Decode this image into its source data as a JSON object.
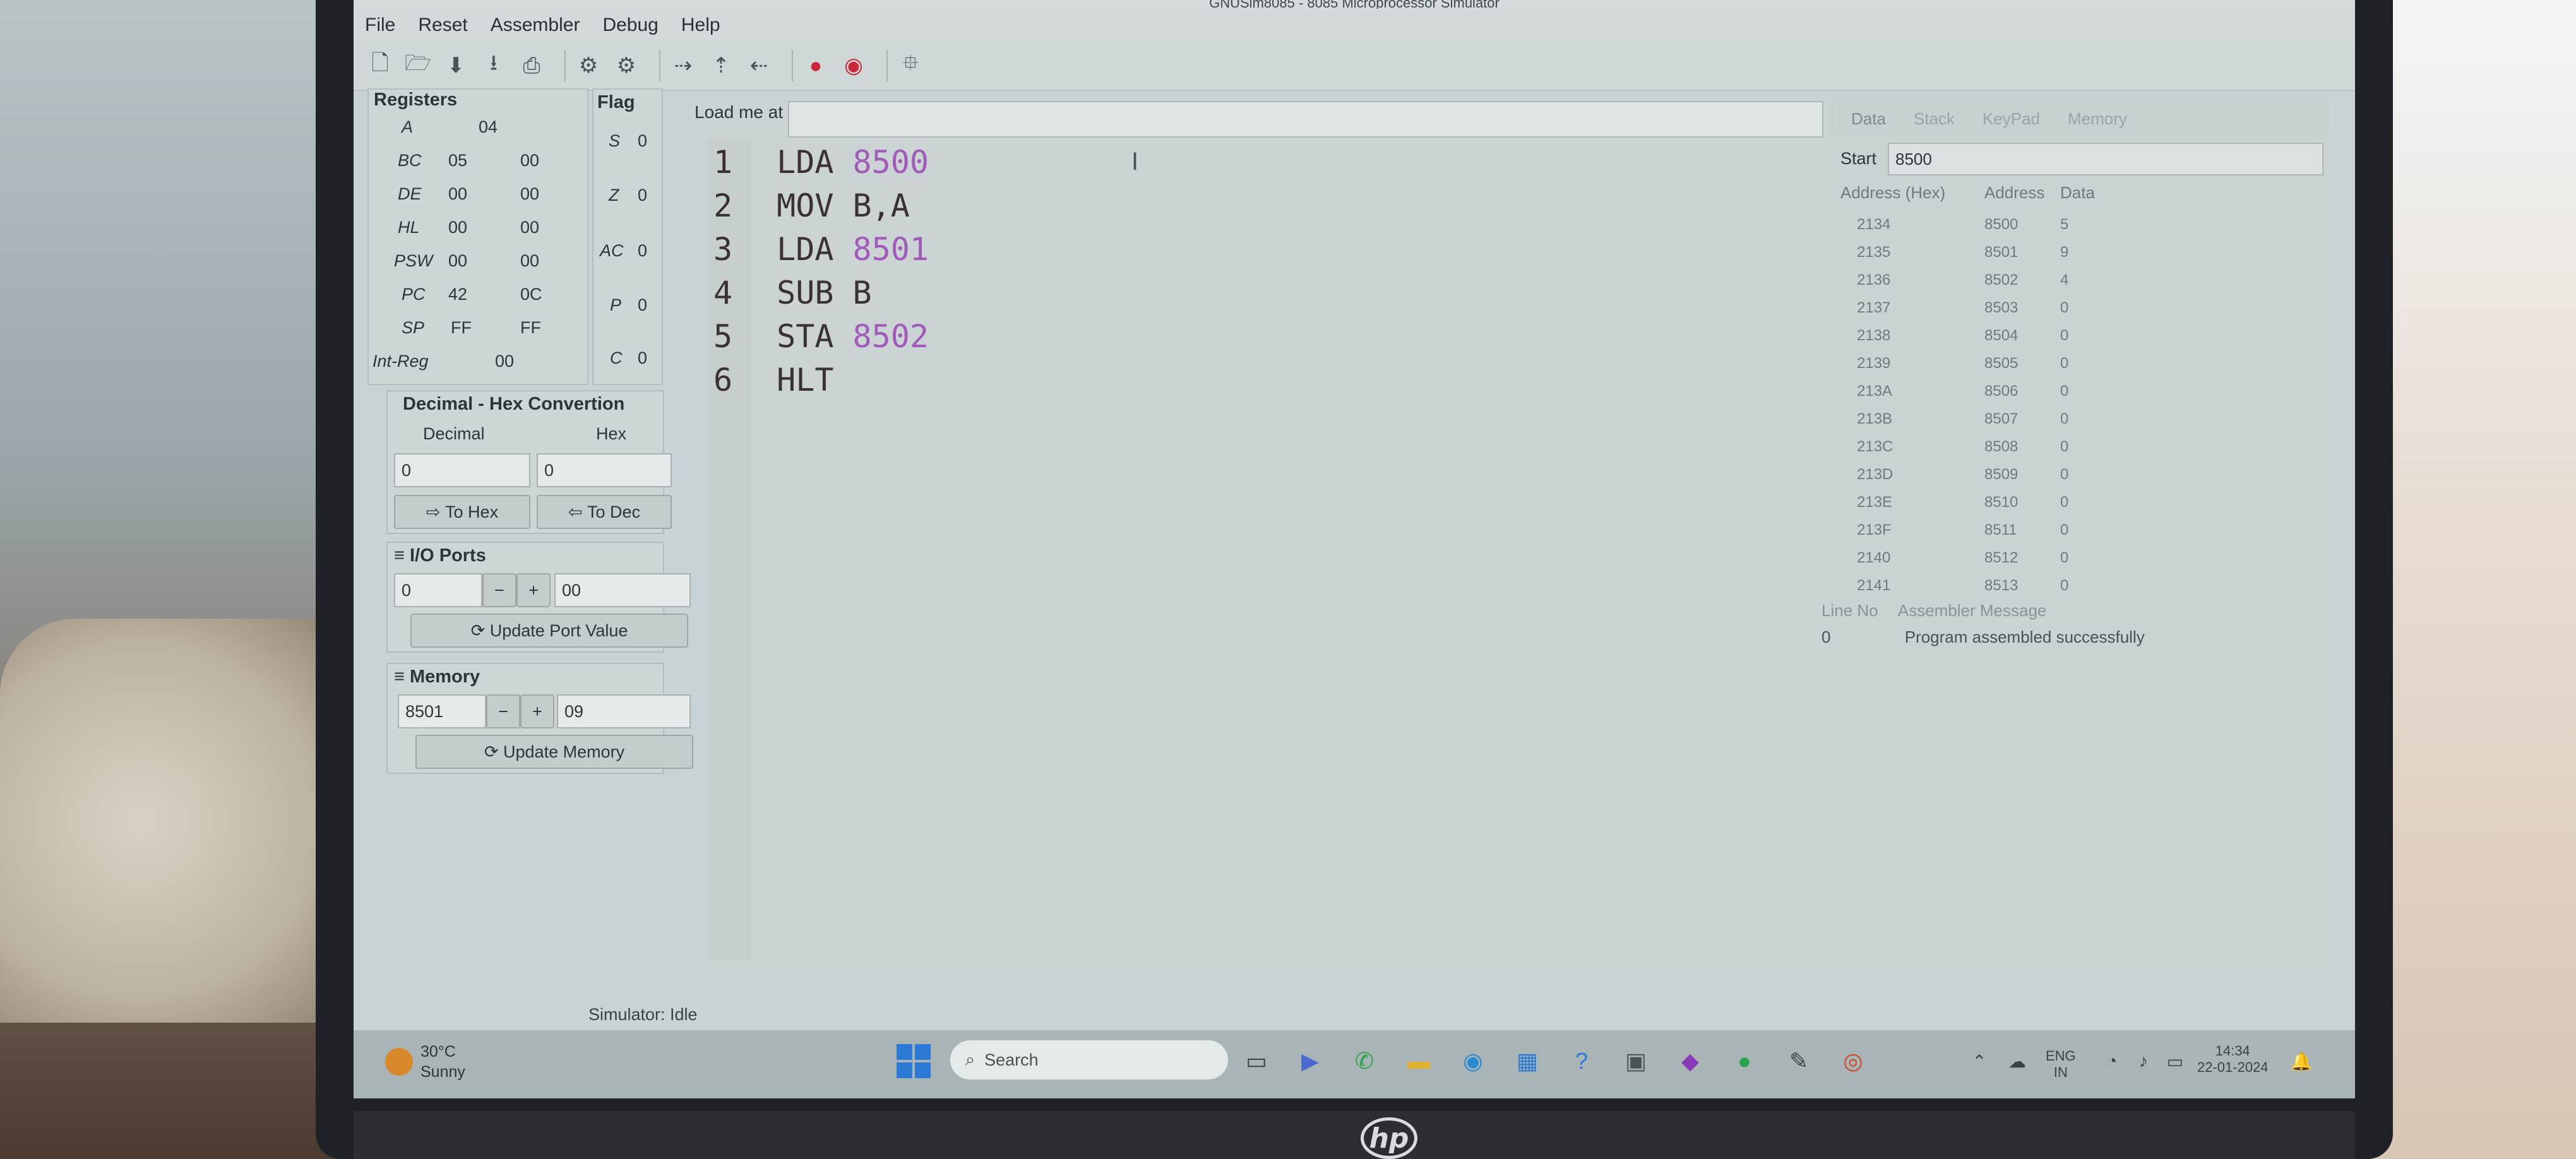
{
  "window": {
    "title": "GNUSim8085 - 8085 Microprocessor Simulator"
  },
  "menu": [
    "File",
    "Reset",
    "Assembler",
    "Debug",
    "Help"
  ],
  "registers": {
    "title": "Registers",
    "rows": [
      {
        "name": "A",
        "v1": "04",
        "v2": ""
      },
      {
        "name": "BC",
        "v1": "05",
        "v2": "00"
      },
      {
        "name": "DE",
        "v1": "00",
        "v2": "00"
      },
      {
        "name": "HL",
        "v1": "00",
        "v2": "00"
      },
      {
        "name": "PSW",
        "v1": "00",
        "v2": "00"
      },
      {
        "name": "PC",
        "v1": "42",
        "v2": "0C"
      },
      {
        "name": "SP",
        "v1": "FF",
        "v2": "FF"
      },
      {
        "name": "Int-Reg",
        "v1": "00",
        "v2": ""
      }
    ]
  },
  "flags": {
    "title": "Flag",
    "rows": [
      {
        "name": "S",
        "v": "0"
      },
      {
        "name": "Z",
        "v": "0"
      },
      {
        "name": "AC",
        "v": "0"
      },
      {
        "name": "P",
        "v": "0"
      },
      {
        "name": "C",
        "v": "0"
      }
    ]
  },
  "conversion": {
    "title": "Decimal - Hex Convertion",
    "decimal_label": "Decimal",
    "hex_label": "Hex",
    "decimal_value": "0",
    "hex_value": "0",
    "to_hex": "To Hex",
    "to_dec": "To Dec"
  },
  "io_ports": {
    "title": "I/O Ports",
    "port": "0",
    "minus": "−",
    "plus": "+",
    "value": "00",
    "update": "Update Port Value"
  },
  "memory": {
    "title": "Memory",
    "address": "8501",
    "minus": "−",
    "plus": "+",
    "value": "09",
    "update": "Update Memory"
  },
  "editor": {
    "load_label": "Load me at",
    "load_value": "",
    "lines": [
      {
        "n": "1",
        "op": "LDA",
        "arg": "8500",
        "numeric": true
      },
      {
        "n": "2",
        "op": "MOV",
        "arg": "B,A",
        "numeric": false
      },
      {
        "n": "3",
        "op": "LDA",
        "arg": "8501",
        "numeric": true
      },
      {
        "n": "4",
        "op": "SUB",
        "arg": "B",
        "numeric": false
      },
      {
        "n": "5",
        "op": "STA",
        "arg": "8502",
        "numeric": true
      },
      {
        "n": "6",
        "op": "HLT",
        "arg": "",
        "numeric": false
      }
    ]
  },
  "data_panel": {
    "tabs": [
      "Data",
      "Stack",
      "KeyPad",
      "Memory"
    ],
    "start_label": "Start",
    "start_value": "8500",
    "headers": [
      "Address (Hex)",
      "Address",
      "Data"
    ],
    "rows": [
      [
        "2134",
        "8500",
        "5"
      ],
      [
        "2135",
        "8501",
        "9"
      ],
      [
        "2136",
        "8502",
        "4"
      ],
      [
        "2137",
        "8503",
        "0"
      ],
      [
        "2138",
        "8504",
        "0"
      ],
      [
        "2139",
        "8505",
        "0"
      ],
      [
        "213A",
        "8506",
        "0"
      ],
      [
        "213B",
        "8507",
        "0"
      ],
      [
        "213C",
        "8508",
        "0"
      ],
      [
        "213D",
        "8509",
        "0"
      ],
      [
        "213E",
        "8510",
        "0"
      ],
      [
        "213F",
        "8511",
        "0"
      ],
      [
        "2140",
        "8512",
        "0"
      ],
      [
        "2141",
        "8513",
        "0"
      ]
    ]
  },
  "messages": {
    "headers": [
      "Line No",
      "Assembler Message"
    ],
    "rows": [
      [
        "0",
        "Program assembled successfully"
      ]
    ]
  },
  "status": "Simulator: Idle",
  "taskbar": {
    "temp": "30°C",
    "weather": "Sunny",
    "search_placeholder": "Search",
    "lang1": "ENG",
    "lang2": "IN",
    "time": "14:34",
    "date": "22-01-2024"
  },
  "brand": "hp",
  "colors": {
    "number": "#a05cb8",
    "record": "#c8283a",
    "windows": "#2c7ad6"
  }
}
